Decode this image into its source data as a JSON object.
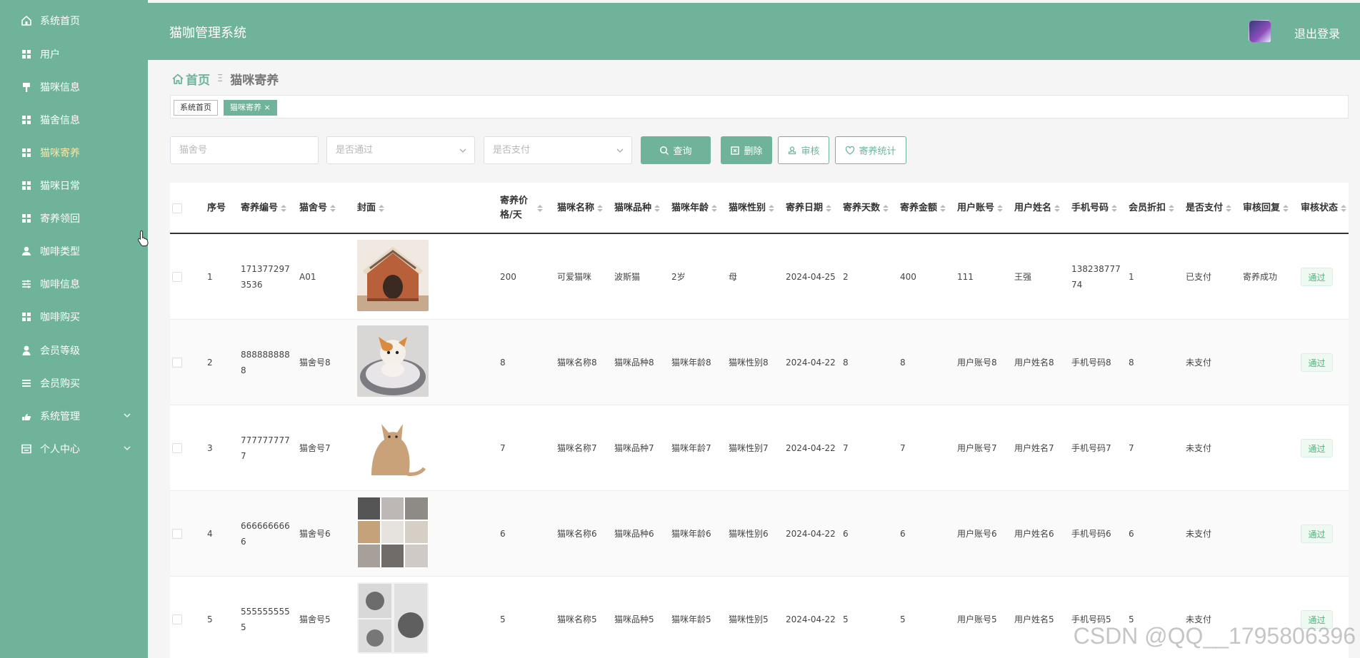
{
  "app": {
    "title": "猫咖管理系统",
    "logout_label": "退出登录"
  },
  "sidebar": {
    "items": [
      {
        "label": "系统首页",
        "icon": "home-icon"
      },
      {
        "label": "用户",
        "icon": "grid-icon"
      },
      {
        "label": "猫咪信息",
        "icon": "signpost-icon"
      },
      {
        "label": "猫舍信息",
        "icon": "grid-icon"
      },
      {
        "label": "猫咪寄养",
        "icon": "grid-icon",
        "active": true
      },
      {
        "label": "猫咪日常",
        "icon": "grid-icon"
      },
      {
        "label": "寄养领回",
        "icon": "grid-icon"
      },
      {
        "label": "咖啡类型",
        "icon": "user-icon"
      },
      {
        "label": "咖啡信息",
        "icon": "sliders-icon"
      },
      {
        "label": "咖啡购买",
        "icon": "grid-icon"
      },
      {
        "label": "会员等级",
        "icon": "person-icon"
      },
      {
        "label": "会员购买",
        "icon": "list-icon"
      },
      {
        "label": "系统管理",
        "icon": "hand-icon",
        "has_children": true
      },
      {
        "label": "个人中心",
        "icon": "card-icon",
        "has_children": true
      }
    ]
  },
  "breadcrumb": {
    "home": "首页",
    "separator": "Ξ",
    "current": "猫咪寄养"
  },
  "tabs": [
    {
      "label": "系统首页"
    },
    {
      "label": "猫咪寄养 ×"
    }
  ],
  "search": {
    "cattery_placeholder": "猫舍号",
    "approved_placeholder": "是否通过",
    "paid_placeholder": "是否支付",
    "query_label": "查询",
    "delete_label": "删除",
    "review_label": "审核",
    "stats_label": "寄养统计"
  },
  "table": {
    "columns": [
      "序号",
      "寄养编号",
      "猫舍号",
      "封面",
      "寄养价格/天",
      "猫咪名称",
      "猫咪品种",
      "猫咪年龄",
      "猫咪性别",
      "寄养日期",
      "寄养天数",
      "寄养金额",
      "用户账号",
      "用户姓名",
      "手机号码",
      "会员折扣",
      "是否支付",
      "审核回复",
      "审核状态"
    ],
    "rows": [
      {
        "no": "1",
        "code": "1713772973536",
        "cattery": "A01",
        "price": "200",
        "name": "可爱猫咪",
        "breed": "波斯猫",
        "age": "2岁",
        "gender": "母",
        "date": "2024-04-25",
        "days": "2",
        "amount": "400",
        "account": "111",
        "username": "王强",
        "phone": "13823877774",
        "discount": "1",
        "paid": "已支付",
        "reply": "寄养成功",
        "status": "通过",
        "cover": "cat-house"
      },
      {
        "no": "2",
        "code": "8888888888",
        "cattery": "猫舍号8",
        "price": "8",
        "name": "猫咪名称8",
        "breed": "猫咪品种8",
        "age": "猫咪年龄8",
        "gender": "猫咪性别8",
        "date": "2024-04-22",
        "days": "8",
        "amount": "8",
        "account": "用户账号8",
        "username": "用户姓名8",
        "phone": "手机号码8",
        "discount": "8",
        "paid": "未支付",
        "reply": "",
        "status": "通过",
        "cover": "kitten-bed"
      },
      {
        "no": "3",
        "code": "7777777777",
        "cattery": "猫舍号7",
        "price": "7",
        "name": "猫咪名称7",
        "breed": "猫咪品种7",
        "age": "猫咪年龄7",
        "gender": "猫咪性别7",
        "date": "2024-04-22",
        "days": "7",
        "amount": "7",
        "account": "用户账号7",
        "username": "用户姓名7",
        "phone": "手机号码7",
        "discount": "7",
        "paid": "未支付",
        "reply": "",
        "status": "通过",
        "cover": "sitting-cat"
      },
      {
        "no": "4",
        "code": "6666666666",
        "cattery": "猫舍号6",
        "price": "6",
        "name": "猫咪名称6",
        "breed": "猫咪品种6",
        "age": "猫咪年龄6",
        "gender": "猫咪性别6",
        "date": "2024-04-22",
        "days": "6",
        "amount": "6",
        "account": "用户账号6",
        "username": "用户姓名6",
        "phone": "手机号码6",
        "discount": "6",
        "paid": "未支付",
        "reply": "",
        "status": "通过",
        "cover": "cat-grid"
      },
      {
        "no": "5",
        "code": "5555555555",
        "cattery": "猫舍号5",
        "price": "5",
        "name": "猫咪名称5",
        "breed": "猫咪品种5",
        "age": "猫咪年龄5",
        "gender": "猫咪性别5",
        "date": "2024-04-22",
        "days": "5",
        "amount": "5",
        "account": "用户账号5",
        "username": "用户姓名5",
        "phone": "手机号码5",
        "discount": "5",
        "paid": "未支付",
        "reply": "",
        "status": "通过",
        "cover": "cat-collage"
      }
    ]
  },
  "watermark": "CSDN @QQ__1795806396",
  "colors": {
    "primary": "#6fb39a",
    "active_text": "#fbe7a6",
    "success": "#55b07c"
  }
}
